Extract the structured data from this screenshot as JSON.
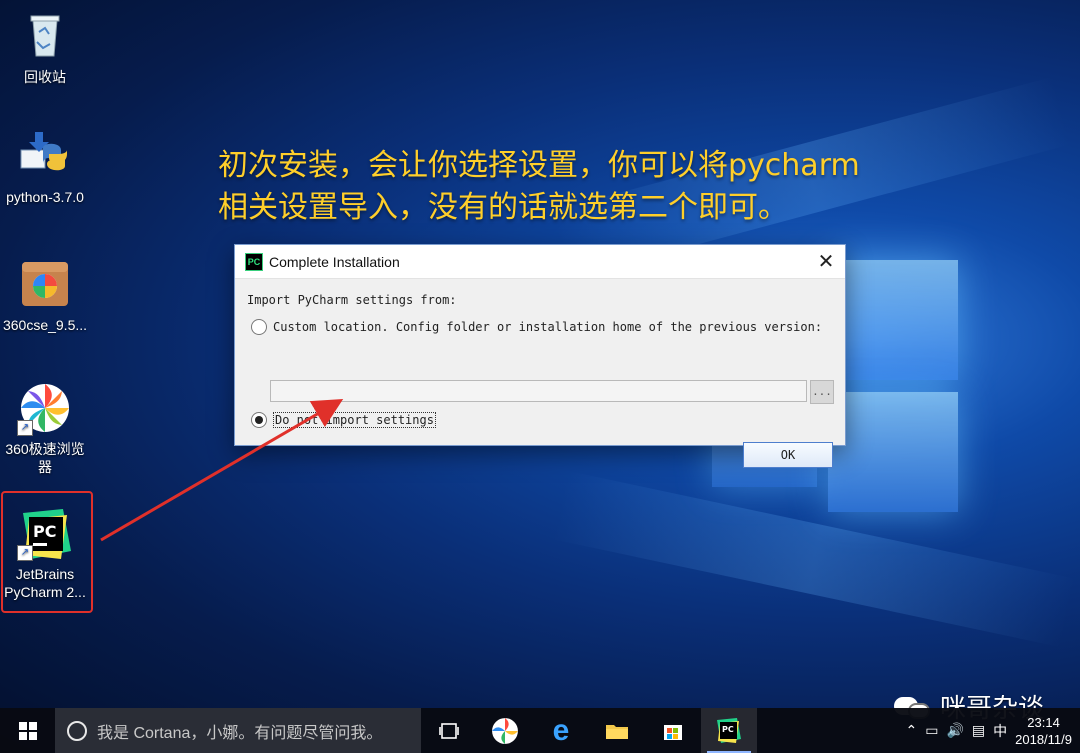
{
  "desktop": {
    "icons": [
      {
        "label": "回收站",
        "icon": "recycle-bin-icon"
      },
      {
        "label": "python-3.7.0",
        "icon": "python-installer-icon"
      },
      {
        "label": "360cse_9.5...",
        "icon": "installer-box-icon"
      },
      {
        "label": "360极速浏览器",
        "icon": "browser-icon"
      },
      {
        "label": "JetBrains PyCharm 2...",
        "icon": "pycharm-icon"
      }
    ],
    "annotation_line1": "初次安装，会让你选择设置，你可以将pycharm",
    "annotation_line2": "相关设置导入，没有的话就选第二个即可。"
  },
  "dialog": {
    "title": "Complete Installation",
    "prompt": "Import PyCharm settings from:",
    "option_custom": "Custom location. Config folder or installation home of the previous version:",
    "path_value": "",
    "browse_label": "...",
    "option_none": "Do not import settings",
    "ok_label": "OK",
    "close_glyph": "✕"
  },
  "taskbar": {
    "search_placeholder": "我是 Cortana，小娜。有问题尽管问我。",
    "time": "23:14",
    "date": "2018/11/9",
    "ime": "中",
    "pinned": [
      "task-view-icon",
      "browser-icon",
      "edge-icon",
      "file-explorer-icon",
      "store-icon",
      "pycharm-icon"
    ]
  },
  "watermark": {
    "text": "咪哥杂谈"
  },
  "colors": {
    "annotation": "#ffcf2a",
    "highlight": "#e0302a",
    "arrow": "#e0302a"
  }
}
